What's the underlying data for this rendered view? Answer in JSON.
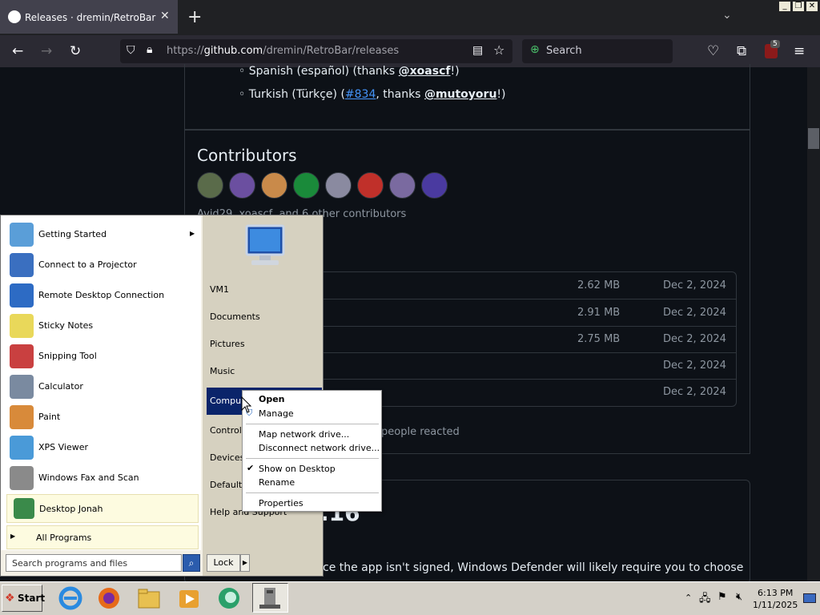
{
  "browser": {
    "tab_title": "Releases · dremin/RetroBar",
    "url_prefix": "https://",
    "url_host": "github.com",
    "url_path": "/dremin/RetroBar/releases",
    "search_placeholder": "Search",
    "extension_badge": "5"
  },
  "page": {
    "translations": [
      {
        "name": "Spanish (español) (thanks ",
        "user": "@xoascf",
        "tail": "!)"
      },
      {
        "name": "Turkish (Türkçe) (",
        "issue": "#834",
        "mid": ", thanks ",
        "user": "@mutoyoru",
        "tail": "!)"
      }
    ],
    "contributors_heading": "Contributors",
    "contributors_text": "Avid29, xoascf, and 6 other contributors",
    "avatar_colors": [
      "#5a6b4a",
      "#6b4fa0",
      "#c98a4a",
      "#1a8a3a",
      "#8a8aa0",
      "#c0302a",
      "#7a6aa0",
      "#4a3aa0"
    ],
    "assets": [
      {
        "size": "2.62 MB",
        "date": "Dec 2, 2024"
      },
      {
        "size": "2.91 MB",
        "date": "Dec 2, 2024"
      },
      {
        "size": "2.75 MB",
        "date": "Dec 2, 2024"
      },
      {
        "size": "",
        "date": "Dec 2, 2024"
      },
      {
        "size": "",
        "date": "Dec 2, 2024"
      }
    ],
    "reactions_text": "people reacted",
    "heading_fragment": ".16",
    "body_fragment": "ce the app isn't signed, Windows Defender will likely require you to choose"
  },
  "start_menu": {
    "programs": [
      {
        "label": "Getting Started",
        "has_arrow": true,
        "color": "#5a9ed8"
      },
      {
        "label": "Connect to a Projector",
        "color": "#3a6fc0"
      },
      {
        "label": "Remote Desktop Connection",
        "color": "#2d6bc4"
      },
      {
        "label": "Sticky Notes",
        "color": "#e9d85a"
      },
      {
        "label": "Snipping Tool",
        "color": "#c94040"
      },
      {
        "label": "Calculator",
        "color": "#7a8aa0"
      },
      {
        "label": "Paint",
        "color": "#d88a3a"
      },
      {
        "label": "XPS Viewer",
        "color": "#4a9ad8"
      },
      {
        "label": "Windows Fax and Scan",
        "color": "#8a8a8a"
      }
    ],
    "pinned": {
      "label": "Desktop Jonah",
      "color": "#3a8a4a"
    },
    "all_programs": "All Programs",
    "right_items": [
      "VM1",
      "Documents",
      "Pictures",
      "Music",
      "Compu",
      "Control",
      "Devices",
      "Default",
      "Help and Support"
    ],
    "search_placeholder": "Search programs and files",
    "lock_label": "Lock"
  },
  "context_menu": {
    "items": [
      {
        "label": "Open",
        "bold": true
      },
      {
        "label": "Manage",
        "icon": "shield-icon"
      },
      {
        "label": "Map network drive..."
      },
      {
        "label": "Disconnect network drive..."
      },
      {
        "label": "Show on Desktop",
        "checked": true
      },
      {
        "label": "Rename"
      },
      {
        "label": "Properties"
      }
    ]
  },
  "taskbar": {
    "start_label": "Start",
    "time": "6:13 PM",
    "date": "1/11/2025"
  }
}
